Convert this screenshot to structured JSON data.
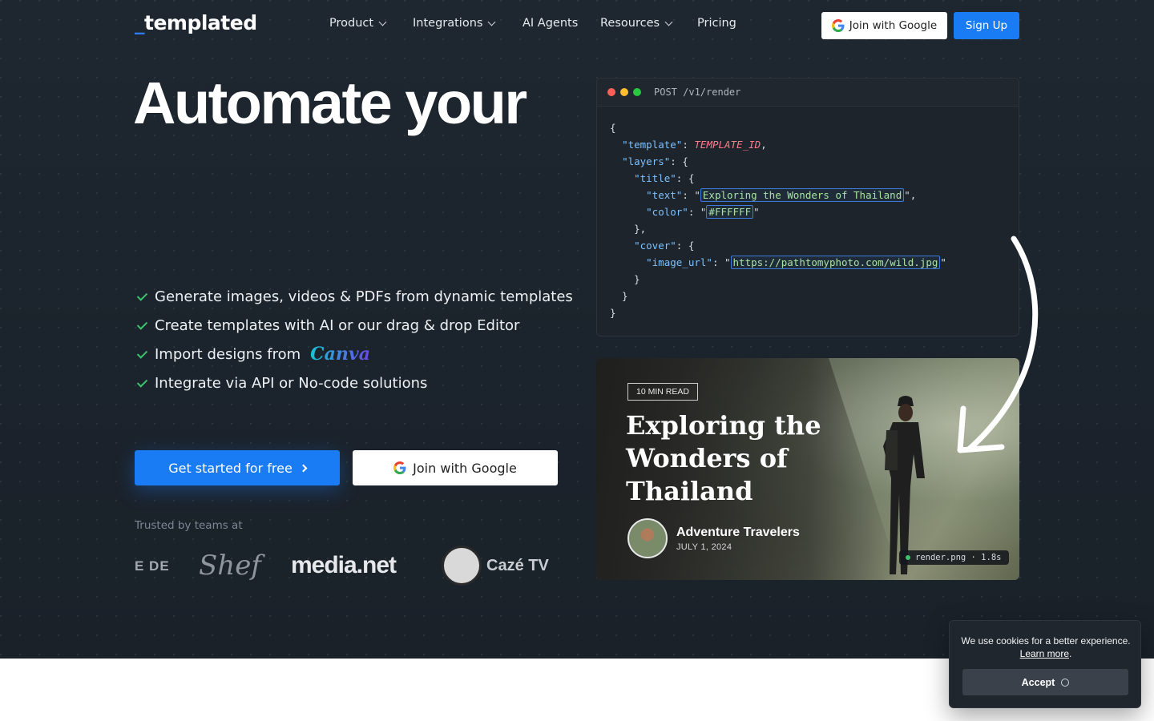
{
  "brand": {
    "logo_text": "templated",
    "logo_prefix": "_"
  },
  "nav": {
    "items": [
      {
        "label": "Product",
        "has_dropdown": true
      },
      {
        "label": "Integrations",
        "has_dropdown": true
      },
      {
        "label": "AI Agents",
        "has_dropdown": false
      },
      {
        "label": "Resources",
        "has_dropdown": true
      },
      {
        "label": "Pricing",
        "has_dropdown": false
      }
    ],
    "google_button": "Join with Google",
    "signup_button": "Sign Up"
  },
  "hero": {
    "headline": "Automate your",
    "features": [
      "Generate images, videos & PDFs from dynamic templates",
      "Create templates with AI or our drag & drop Editor",
      "Import designs from",
      "Integrate via API or No-code solutions"
    ],
    "canva_word": "Canva",
    "cta_primary": "Get started for free",
    "cta_google": "Join with Google",
    "trusted_label": "Trusted by teams at",
    "logos": [
      "E DE",
      "Shef",
      "media.net",
      "Cazé TV"
    ]
  },
  "code_panel": {
    "endpoint": "POST /v1/render",
    "template_key": "\"template\"",
    "template_value": "TEMPLATE_ID",
    "layers_key": "\"layers\"",
    "title_key": "\"title\"",
    "text_key": "\"text\"",
    "text_value": "Exploring the Wonders of Thailand",
    "color_key": "\"color\"",
    "color_value": "#FFFFFF",
    "cover_key": "\"cover\"",
    "image_url_key": "\"image_url\"",
    "image_url_value": "https://pathtomyphoto.com/wild.jpg"
  },
  "preview": {
    "badge": "10 MIN READ",
    "title": "Exploring the Wonders of Thailand",
    "author": "Adventure Travelers",
    "date": "JULY 1, 2024",
    "render_tag": "render.png · 1.8s"
  },
  "cookie": {
    "message": "We use cookies for a better experience.",
    "learn_more": "Learn more",
    "accept": "Accept"
  },
  "colors": {
    "accent": "#1a7cf5",
    "hero_bg": "#1e2630",
    "check": "#3bc46b"
  }
}
